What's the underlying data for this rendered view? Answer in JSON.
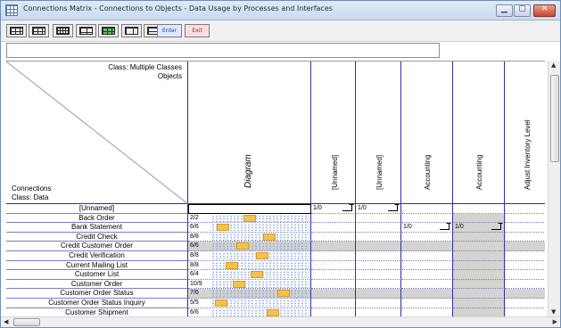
{
  "window": {
    "title": "Connections Matrix - Connections to Objects - Data Usage by Processes and Interfaces",
    "minimize_glyph": "▁",
    "maximize_glyph": "▢",
    "close_glyph": "✕"
  },
  "toolbar": {
    "buttons": [
      {
        "icon": "grid-icon"
      },
      {
        "icon": "split-grid-icon"
      },
      {
        "icon": "document-icon"
      },
      {
        "icon": "connector-icon"
      },
      {
        "icon": "green-grid-icon"
      },
      {
        "icon": "insert-columns-icon"
      },
      {
        "icon": "insert-rows-icon"
      }
    ],
    "enter_label": "Enter",
    "exit_label": "Exit"
  },
  "command_input": {
    "value": ""
  },
  "matrix": {
    "corner": {
      "class_label": "Class: Multiple Classes",
      "objects_label": "Objects",
      "connections_label": "Connections",
      "data_class_label": "Class: Data"
    },
    "columns": [
      {
        "label": "Diagram"
      },
      {
        "label": "[Unnamed]"
      },
      {
        "label": "[Unnamed]"
      },
      {
        "label": "Accounting"
      },
      {
        "label": "Accounting"
      },
      {
        "label": "Adjust Inventory Level"
      }
    ],
    "rows": [
      {
        "label": "[Unnamed]",
        "counts": [
          "",
          "1/0",
          "1/0",
          "",
          "",
          ""
        ]
      },
      {
        "label": "Back Order",
        "counts": [
          "2/2",
          "",
          "",
          "",
          "",
          ""
        ]
      },
      {
        "label": "Bank Statement",
        "counts": [
          "6/6",
          "",
          "",
          "1/0",
          "1/0",
          ""
        ]
      },
      {
        "label": "Credit Check",
        "counts": [
          "8/8",
          "",
          "",
          "",
          "",
          ""
        ]
      },
      {
        "label": "Credit Customer Order",
        "counts": [
          "6/6",
          "",
          "",
          "",
          "",
          ""
        ]
      },
      {
        "label": "Credit Verification",
        "counts": [
          "8/8",
          "",
          "",
          "",
          "",
          ""
        ]
      },
      {
        "label": "Current Mailing List",
        "counts": [
          "8/8",
          "",
          "",
          "",
          "",
          ""
        ]
      },
      {
        "label": "Customer List",
        "counts": [
          "6/4",
          "",
          "",
          "",
          "",
          ""
        ]
      },
      {
        "label": "Customer Order",
        "counts": [
          "10/9",
          "",
          "",
          "",
          "",
          ""
        ]
      },
      {
        "label": "Customer Order Status",
        "counts": [
          "7/6",
          "",
          "",
          "",
          "",
          ""
        ]
      },
      {
        "label": "Customer Order Status Inquiry",
        "counts": [
          "5/5",
          "",
          "",
          "",
          "",
          ""
        ]
      },
      {
        "label": "Customer Shipment",
        "counts": [
          "6/6",
          "",
          "",
          "",
          "",
          ""
        ]
      }
    ]
  },
  "colors": {
    "grid_line": "#2f2fa3",
    "highlight_row": "#d3d3cf",
    "diagram_mark": "#f2c24e"
  }
}
